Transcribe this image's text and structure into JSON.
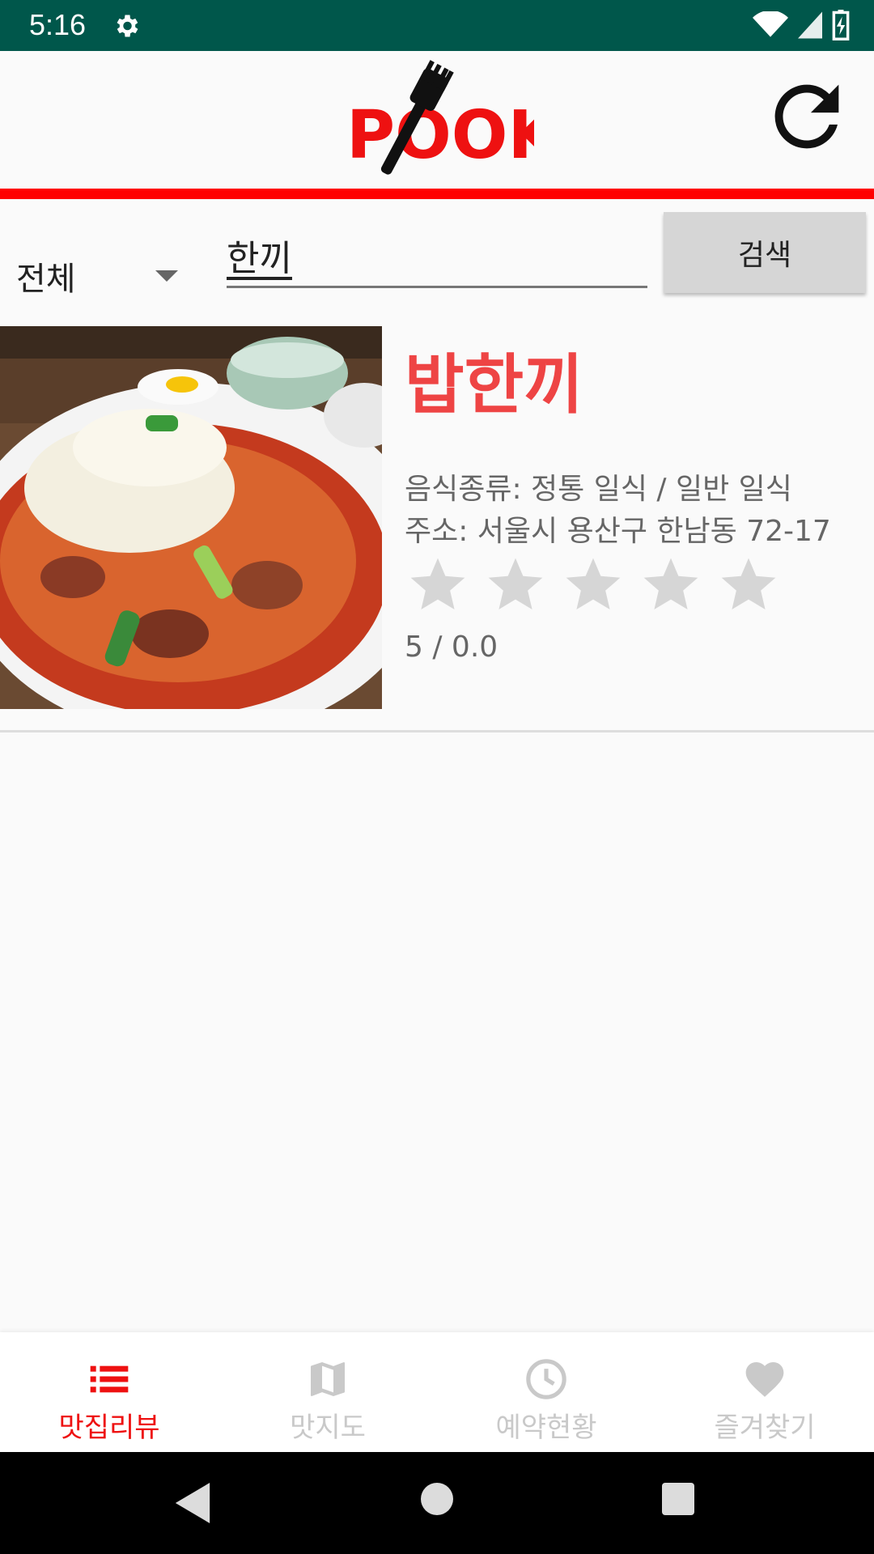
{
  "status_bar": {
    "time": "5:16"
  },
  "header": {
    "logo_text": "POOK"
  },
  "search": {
    "category": "전체",
    "query": "한끼",
    "button_label": "검색"
  },
  "restaurants": [
    {
      "name": "밥한끼",
      "food_type": "음식종류: 정통 일식 / 일반 일식",
      "address": "주소: 서울시 용산구 한남동 72-17",
      "rating_text": "5 / 0.0",
      "rating": 0,
      "max_rating": 5
    }
  ],
  "bottom_nav": {
    "items": [
      {
        "label": "맛집리뷰",
        "icon": "list-icon",
        "active": true
      },
      {
        "label": "맛지도",
        "icon": "map-icon",
        "active": false
      },
      {
        "label": "예약현황",
        "icon": "clock-icon",
        "active": false
      },
      {
        "label": "즐겨찾기",
        "icon": "heart-icon",
        "active": false
      }
    ]
  },
  "colors": {
    "accent": "#ee1111",
    "status_bar": "#00574b",
    "name_red": "#ee4444",
    "star_empty": "#d6d6d6"
  }
}
